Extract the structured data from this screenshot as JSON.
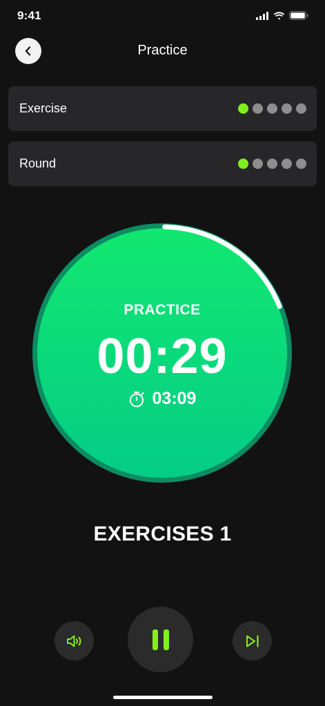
{
  "status_bar": {
    "time": "9:41"
  },
  "header": {
    "title": "Practice",
    "back_icon": "chevron-left-icon"
  },
  "progress": [
    {
      "label": "Exercise",
      "total": 5,
      "completed": 1
    },
    {
      "label": "Round",
      "total": 5,
      "completed": 1
    }
  ],
  "timer": {
    "phase": "PRACTICE",
    "countdown": "00:29",
    "total_time": "03:09",
    "total_icon": "stopwatch-icon",
    "arc_fraction": 0.19
  },
  "exercise": {
    "name": "EXERCISES 1"
  },
  "controls": {
    "sound_icon": "speaker-icon",
    "pause_icon": "pause-icon",
    "skip_icon": "skip-next-icon"
  },
  "colors": {
    "background": "#121212",
    "card": "#27272a",
    "accent": "#7ff01e",
    "timer_gradient_top": "#12e76f",
    "timer_gradient_bottom": "#04cd86",
    "ring": "#0d8c63",
    "dot_inactive": "#8e8e8e"
  }
}
